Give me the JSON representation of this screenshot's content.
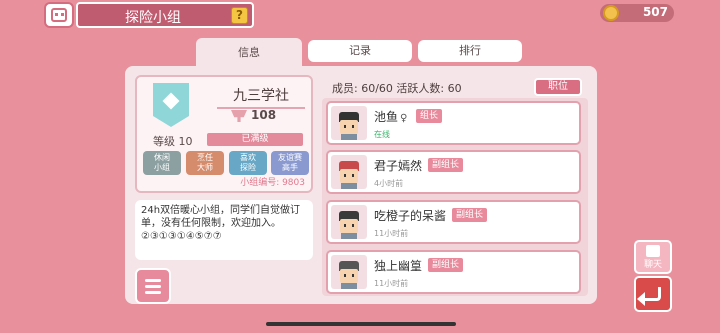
{
  "header": {
    "title": "探险小组",
    "help_label": "?",
    "coins": "507"
  },
  "tabs": [
    {
      "label": "信息"
    },
    {
      "label": "记录"
    },
    {
      "label": "排行"
    }
  ],
  "club": {
    "name": "九三学社",
    "trophies": "108",
    "level_label": "等级 10",
    "level_status": "已满级",
    "tags": [
      "休闲\n小组",
      "烹任\n大师",
      "喜欢\n探险",
      "友谊赛\n高手"
    ],
    "club_id": "小组编号: 9803",
    "description": "24h双倍暖心小组，同学们自觉做订单，没有任何限制，欢迎加入。②③①③①④⑤⑦⑦"
  },
  "members": {
    "summary": "成员: 60/60  活跃人数: 60",
    "position_button": "职位",
    "list": [
      {
        "name": "池鱼",
        "gender": "♀",
        "role": "组长",
        "status": "在线",
        "online": true,
        "hair": "#333333"
      },
      {
        "name": "君子嫣然",
        "gender": "",
        "role": "副组长",
        "status": "4小时前",
        "online": false,
        "hair": "#c94a4a"
      },
      {
        "name": "吃橙子的呆酱",
        "gender": "",
        "role": "副组长",
        "status": "11小时前",
        "online": false,
        "hair": "#3a3a3a"
      },
      {
        "name": "独上幽篁",
        "gender": "",
        "role": "副组长",
        "status": "11小时前",
        "online": false,
        "hair": "#555555"
      }
    ]
  },
  "sidebar": {
    "chat_label": "聊天"
  },
  "colors": {
    "background": "#e8909c",
    "accent": "#d96e82"
  }
}
